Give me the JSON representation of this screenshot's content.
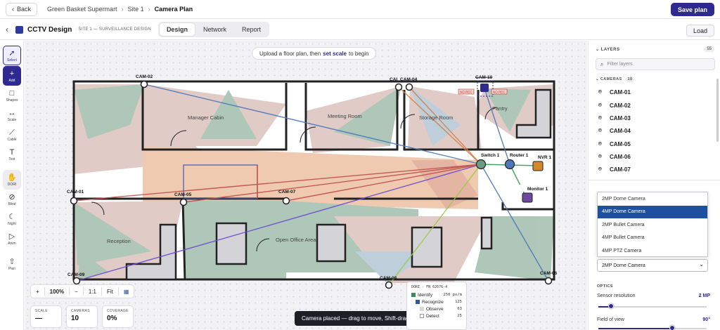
{
  "topbar": {
    "back_label": "Back",
    "breadcrumb": [
      "Green Basket Supermart",
      "Site 1",
      "Camera Plan"
    ],
    "save_label": "Save plan"
  },
  "project": {
    "title": "CCTV Design",
    "subtitle": "· SITE 1 — SURVEILLANCE DESIGN",
    "tabs": [
      "Design",
      "Network",
      "Report"
    ],
    "active_tab": "Design",
    "load_label": "Load"
  },
  "tools": [
    {
      "label": "Select",
      "icon": "cursor-icon"
    },
    {
      "label": "Add",
      "icon": "plus-icon"
    },
    {
      "label": "Shapes",
      "icon": "square-icon"
    },
    {
      "label": "Scale",
      "icon": "ruler-icon"
    },
    {
      "label": "Cable",
      "icon": "cable-icon"
    },
    {
      "label": "Text",
      "icon": "text-icon"
    },
    {
      "label": "DORI",
      "icon": "hand-icon"
    },
    {
      "label": "Blind",
      "icon": "blind-icon"
    },
    {
      "label": "Night",
      "icon": "moon-icon"
    },
    {
      "label": "Anim",
      "icon": "play-icon"
    },
    {
      "label": "Plan",
      "icon": "upload-icon"
    }
  ],
  "canvas": {
    "hint_pre": "Upload a floor plan, then",
    "hint_link": "set scale",
    "hint_post": "to begin",
    "rooms": [
      "Manager Cabin",
      "Meeting Room",
      "Storage Room",
      "Pantry",
      "Reception",
      "Open Office Area"
    ],
    "cameras": [
      "CAM-01",
      "CAM-02",
      "CAM-03",
      "CAM-04",
      "CAM-05",
      "CAM-06",
      "CAM-07",
      "CAM-08",
      "CAM-09",
      "CAM-10"
    ],
    "cam03_partial": "CAI",
    "devices": [
      "Switch 1",
      "Router 1",
      "NVR 1",
      "Monitor 1"
    ],
    "no_rec": "NO REC",
    "zoom": {
      "plus": "+",
      "level": "100%",
      "minus": "−",
      "ratio": "1:1",
      "fit": "Fit"
    },
    "stats": [
      {
        "label": "SCALE",
        "value": "—"
      },
      {
        "label": "CAMERAS",
        "value": "10"
      },
      {
        "label": "COVERAGE",
        "value": "0%"
      }
    ],
    "toast": "Camera placed — drag to move, Shift-drag to aim",
    "dori": {
      "header": "DORI · FN 62676-4",
      "rows": [
        {
          "name": "Identify",
          "value": "250 px/m",
          "color": "#3a8a5a"
        },
        {
          "name": "Recognize",
          "value": "125",
          "color": "#2e5a9a"
        },
        {
          "name": "Observe",
          "value": "63",
          "color": "#d7d7d7"
        },
        {
          "name": "Detect",
          "value": "25",
          "color": "#ffffff"
        }
      ]
    }
  },
  "panel": {
    "layers_title": "LAYERS",
    "layers_count": "55",
    "filter_placeholder": "Filter layers",
    "cameras_title": "CAMERAS",
    "cameras_count": "10",
    "camera_list": [
      "CAM-01",
      "CAM-02",
      "CAM-03",
      "CAM-04",
      "CAM-05",
      "CAM-06",
      "CAM-07"
    ],
    "model_options": [
      "2MP Dome Camera",
      "4MP Dome Camera",
      "2MP Bullet Camera",
      "4MP Bullet Camera",
      "4MP PTZ Camera"
    ],
    "model_selected": "2MP Dome Camera",
    "optics_title": "OPTICS",
    "sensor_label": "Sensor resolution",
    "sensor_value": "2 MP",
    "sensor_fraction": 0.12,
    "fov_label": "Field of view",
    "fov_value": "90°",
    "fov_fraction": 0.68
  },
  "colors": {
    "accent": "#2e2a8f",
    "selected_option": "#1f4fa0"
  }
}
